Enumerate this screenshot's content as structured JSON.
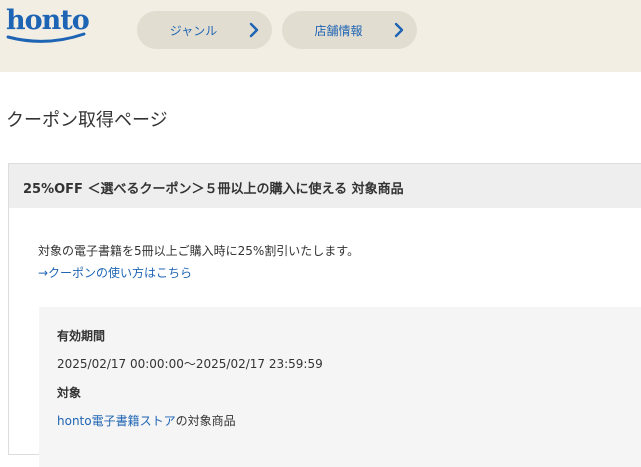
{
  "header": {
    "logo_text": "honto",
    "nav": [
      {
        "label": "ジャンル"
      },
      {
        "label": "店舗情報"
      }
    ]
  },
  "page": {
    "title": "クーポン取得ページ"
  },
  "coupon": {
    "title": "25%OFF ＜選べるクーポン＞５冊以上の購入に使える 対象商品",
    "description": "対象の電子書籍を5冊以上ご購入時に25%割引いたします。",
    "howto_link": "→クーポンの使い方はこちら",
    "period_label": "有効期間",
    "period_value": "2025/02/17 00:00:00～2025/02/17 23:59:59",
    "target_label": "対象",
    "target_link": "honto電子書籍ストア",
    "target_suffix": "の対象商品"
  },
  "colors": {
    "brand_blue": "#1e64b4",
    "header_bg": "#f2eee4",
    "pill_bg": "#e2ddd1",
    "coupon_head_bg": "#eeeeee",
    "detail_bg": "#f5f5f5"
  }
}
